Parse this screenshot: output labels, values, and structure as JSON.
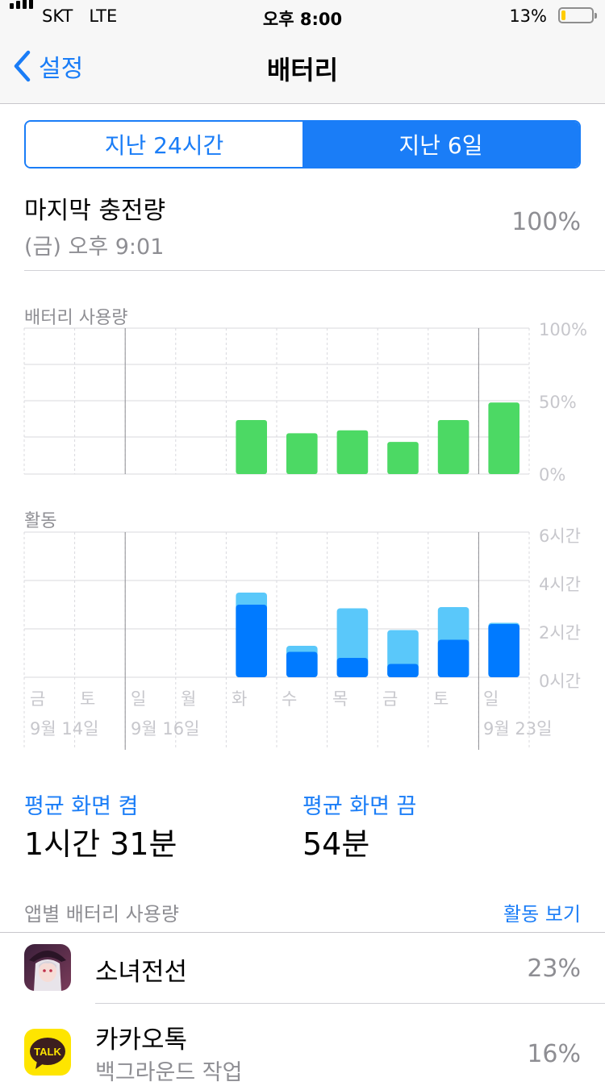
{
  "status_bar": {
    "carrier": "SKT",
    "network": "LTE",
    "time": "오후 8:00",
    "battery_percent": "13%",
    "battery_level": 0.13,
    "battery_color": "#ffcc00"
  },
  "nav": {
    "back_label": "설정",
    "title": "배터리"
  },
  "segmented": {
    "options": [
      "지난 24시간",
      "지난 6일"
    ],
    "selected_index": 1,
    "accent": "#1a7df7"
  },
  "last_charge": {
    "title": "마지막 충전량",
    "time": "(금) 오후 9:01",
    "value": "100%"
  },
  "battery_chart": {
    "label": "배터리 사용량",
    "y_ticks": [
      "100%",
      "50%",
      "0%"
    ]
  },
  "activity_chart": {
    "label": "활동",
    "y_ticks": [
      "6시간",
      "4시간",
      "2시간",
      "0시간"
    ]
  },
  "x_axis": {
    "days": [
      "금",
      "토",
      "일",
      "월",
      "화",
      "수",
      "목",
      "금",
      "토",
      "일"
    ],
    "dates": [
      {
        "label": "9월 14일",
        "day_index": 0
      },
      {
        "label": "9월 16일",
        "day_index": 2
      },
      {
        "label": "9월 23일",
        "day_index": 9
      }
    ]
  },
  "chart_data": [
    {
      "type": "bar",
      "title": "배터리 사용량",
      "categories": [
        "금",
        "토",
        "일",
        "월",
        "화",
        "수",
        "목",
        "금",
        "토",
        "일"
      ],
      "values": [
        0,
        0,
        0,
        0,
        37,
        28,
        30,
        22,
        37,
        49
      ],
      "ylim": [
        0,
        100
      ],
      "y_tick_labels": [
        "0%",
        "50%",
        "100%"
      ],
      "color": "#4cd964",
      "grid": true
    },
    {
      "type": "bar",
      "title": "활동",
      "categories": [
        "금",
        "토",
        "일",
        "월",
        "화",
        "수",
        "목",
        "금",
        "토",
        "일"
      ],
      "stacked": true,
      "series": [
        {
          "values": [
            0,
            0,
            0,
            0,
            3.0,
            1.05,
            0.8,
            0.55,
            1.55,
            2.2
          ],
          "color": "#007aff"
        },
        {
          "values": [
            0,
            0,
            0,
            0,
            0.5,
            0.25,
            2.05,
            1.4,
            1.35,
            0.05
          ],
          "color": "#5ac8fa"
        }
      ],
      "ylim": [
        0,
        6
      ],
      "y_tick_labels": [
        "0시간",
        "2시간",
        "4시간",
        "6시간"
      ],
      "grid": true
    }
  ],
  "stats": {
    "screen_on_label": "평균 화면 켬",
    "screen_on_value": "1시간 31분",
    "screen_off_label": "평균 화면 끔",
    "screen_off_value": "54분"
  },
  "app_usage": {
    "header": "앱별 배터리 사용량",
    "activity_link": "활동 보기",
    "link_color": "#1a7df7",
    "apps": [
      {
        "name": "소녀전선",
        "icon": "girls-frontline-app-icon",
        "percent": "23%",
        "subtitle": ""
      },
      {
        "name": "카카오톡",
        "icon": "kakaotalk-app-icon",
        "icon_text": "TALK",
        "percent": "16%",
        "subtitle": "백그라운드 작업"
      }
    ]
  }
}
